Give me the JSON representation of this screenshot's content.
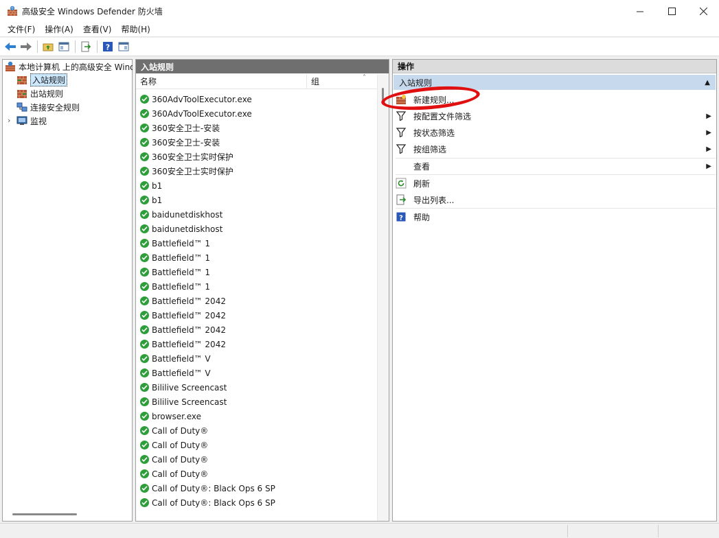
{
  "window": {
    "title": "高级安全 Windows Defender 防火墙"
  },
  "menu": [
    "文件(F)",
    "操作(A)",
    "查看(V)",
    "帮助(H)"
  ],
  "tree": {
    "root": "本地计算机 上的高级安全 Windows Defender 防火墙",
    "items": [
      "入站规则",
      "出站规则",
      "连接安全规则",
      "监视"
    ]
  },
  "middle": {
    "header": "入站规则",
    "columns": [
      "名称",
      "组"
    ],
    "rows": [
      "360AdvToolExecutor.exe",
      "360AdvToolExecutor.exe",
      "360安全卫士-安装",
      "360安全卫士-安装",
      "360安全卫士实时保护",
      "360安全卫士实时保护",
      "b1",
      "b1",
      "baidunetdiskhost",
      "baidunetdiskhost",
      "Battlefield™ 1",
      "Battlefield™ 1",
      "Battlefield™ 1",
      "Battlefield™ 1",
      "Battlefield™ 2042",
      "Battlefield™ 2042",
      "Battlefield™ 2042",
      "Battlefield™ 2042",
      "Battlefield™ V",
      "Battlefield™ V",
      "Bililive Screencast",
      "Bililive Screencast",
      "browser.exe",
      "Call of Duty®",
      "Call of Duty®",
      "Call of Duty®",
      "Call of Duty®",
      "Call of Duty®: Black Ops 6 SP",
      "Call of Duty®: Black Ops 6 SP"
    ]
  },
  "actions": {
    "header": "操作",
    "section": "入站规则",
    "items": [
      "新建规则...",
      "按配置文件筛选",
      "按状态筛选",
      "按组筛选",
      "查看",
      "刷新",
      "导出列表...",
      "帮助"
    ]
  },
  "colors": {
    "accent": "#c7d9ed",
    "check": "#2e9e3a",
    "annotation": "#e01010"
  }
}
